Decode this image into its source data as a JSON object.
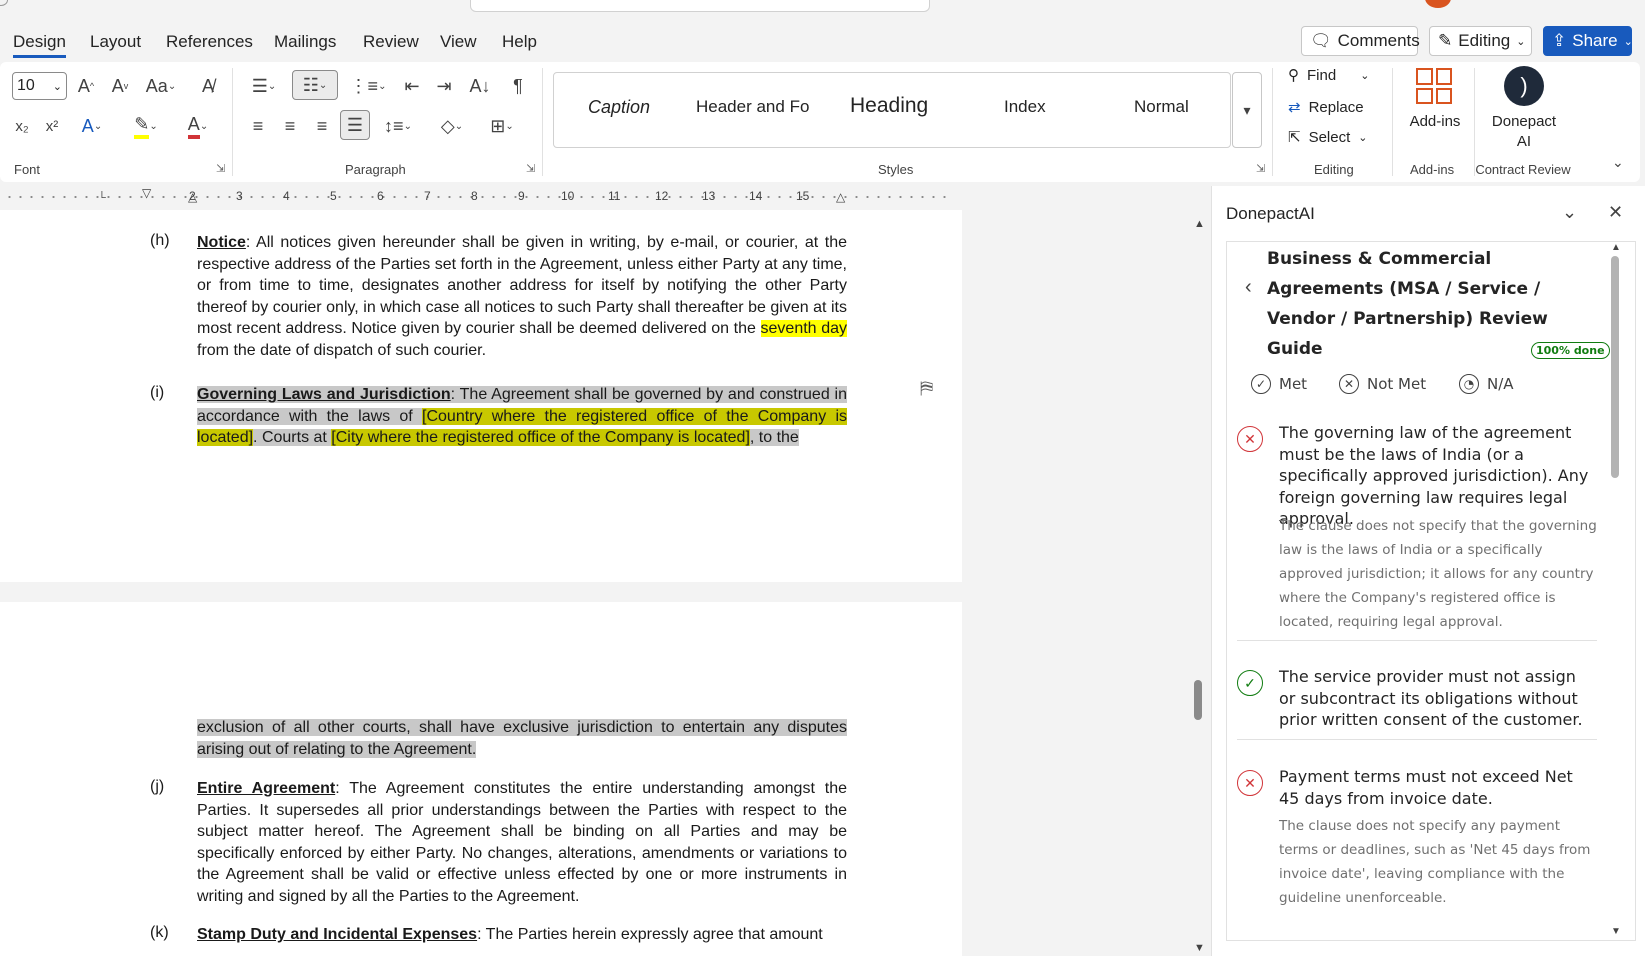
{
  "tabs": [
    {
      "label": "Design",
      "active": true
    },
    {
      "label": "Layout"
    },
    {
      "label": "References"
    },
    {
      "label": "Mailings"
    },
    {
      "label": "Review"
    },
    {
      "label": "View"
    },
    {
      "label": "Help"
    }
  ],
  "top_buttons": {
    "comments": "Comments",
    "editing": "Editing",
    "share": "Share"
  },
  "ribbon": {
    "font": {
      "size": "10",
      "group_label": "Font"
    },
    "paragraph": {
      "group_label": "Paragraph"
    },
    "styles": {
      "items": [
        "Caption",
        "Header and Fo",
        "Heading",
        "Index",
        "Normal"
      ],
      "group_label": "Styles"
    },
    "editing": {
      "find": "Find",
      "replace": "Replace",
      "select": "Select",
      "group_label": "Editing"
    },
    "addins": {
      "label": "Add-ins",
      "group_label": "Add-ins"
    },
    "donepact": {
      "label_line1": "Donepact",
      "label_line2": "AI",
      "group_label": "Contract Review"
    }
  },
  "ruler": {
    "numbers": [
      "2",
      "3",
      "4",
      "5",
      "6",
      "7",
      "8",
      "9",
      "10",
      "11",
      "12",
      "13",
      "14",
      "15"
    ]
  },
  "document": {
    "clause_h": {
      "letter": "(h)",
      "heading": "Notice",
      "text_a": ": All notices given hereunder shall be given in writing, by e-mail, or courier, at the respective address of the Parties set forth in the Agreement, unless either Party at any time, or from time to time, designates another address for itself by notifying the other Party thereof by courier only, in which case all notices to such Party shall thereafter be given at its most recent address. Notice given by courier shall be deemed delivered on the ",
      "highlight": "seventh day",
      "text_b": " from the date of dispatch of such courier."
    },
    "clause_i": {
      "letter": "(i)",
      "heading": "Governing Laws and Jurisdiction",
      "text_a": ": The Agreement shall be governed by and construed in accordance with the laws of ",
      "placeholder_country": "[Country where the registered office of the Company is located]",
      "text_b": ". Courts at ",
      "placeholder_city": "[City where the registered office of the Company is located]",
      "text_c": ", to the",
      "continuation": "exclusion of all other courts, shall have exclusive jurisdiction to entertain any disputes arising out of relating to the Agreement."
    },
    "clause_j": {
      "letter": "(j)",
      "heading": "Entire Agreement",
      "text": ": The Agreement constitutes the entire understanding amongst the Parties. It supersedes all prior understandings between the Parties with respect to the subject matter hereof. The Agreement shall be binding on all Parties and may be specifically enforced by either Party. No changes, alterations, amendments or variations to the Agreement shall be valid or effective unless effected by one or more instruments in writing and signed by all the Parties to the Agreement."
    },
    "clause_k": {
      "letter": "(k)",
      "heading": "Stamp Duty and Incidental Expenses",
      "text": ": The Parties herein expressly agree that amount"
    }
  },
  "pane": {
    "title": "DonepactAI",
    "guide_title": "Business & Commercial Agreements (MSA / Service / Vendor / Partnership) Review Guide",
    "progress": "100% done",
    "filters": {
      "met": "Met",
      "not_met": "Not Met",
      "na": "N/A"
    },
    "checks": [
      {
        "status": "not-met",
        "text": "The governing law of the agreement must be the laws of India (or a specifically approved jurisdiction). Any foreign governing law requires legal approval.",
        "note": "The clause does not specify that the governing law is the laws of India or a specifically approved jurisdiction; it allows for any country where the Company's registered office is located, requiring legal approval."
      },
      {
        "status": "met",
        "text": "The service provider must not assign or subcontract its obligations without prior written consent of the customer.",
        "note": ""
      },
      {
        "status": "not-met",
        "text": "Payment terms must not exceed Net 45 days from invoice date.",
        "note": "The clause does not specify any payment terms or deadlines, such as 'Net 45 days from invoice date', leaving compliance with the guideline unenforceable."
      }
    ]
  },
  "colors": {
    "accent": "#185abd",
    "fail": "#d13438",
    "pass": "#107c10",
    "highlight_yellow": "#ffff00",
    "highlight_grey": "#c8c8c8"
  }
}
